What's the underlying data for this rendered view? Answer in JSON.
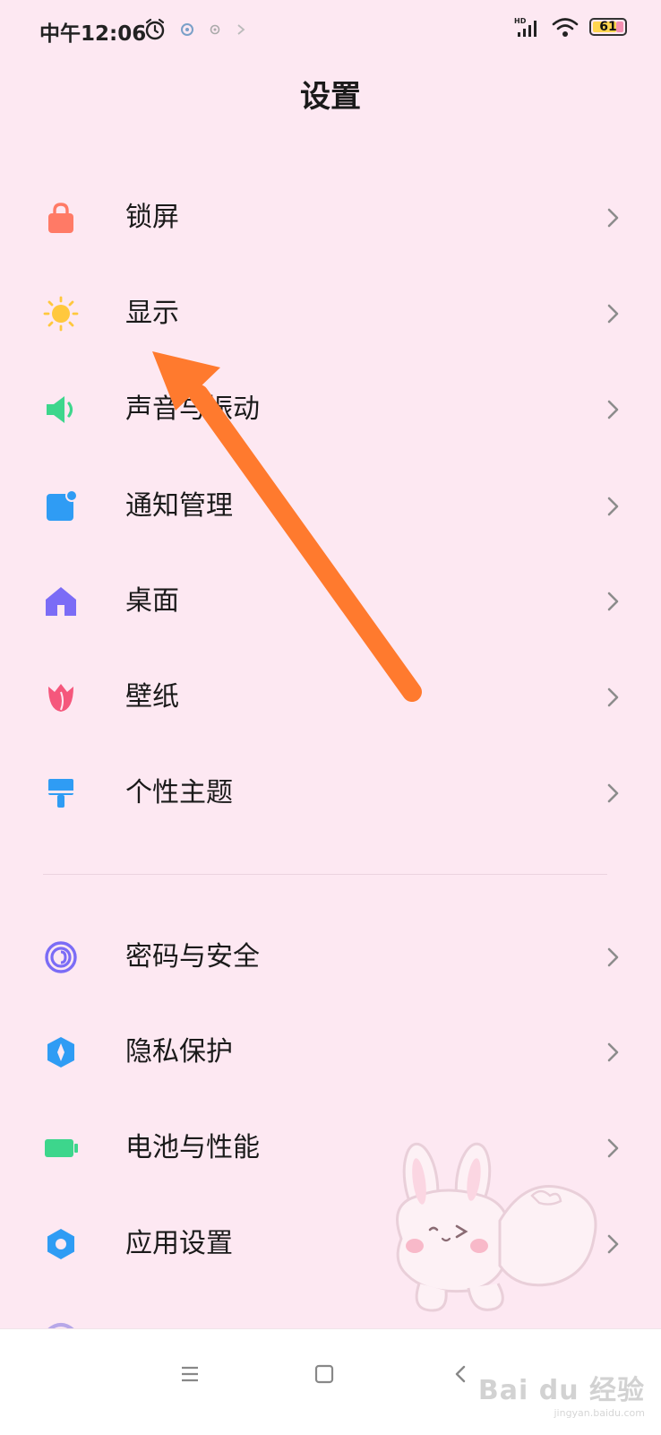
{
  "status_bar": {
    "time": "中午12:06",
    "battery_level": "61",
    "signal_label": "HD",
    "icons": [
      "alarm-icon",
      "app-notification-icon",
      "gear-notification-icon",
      "link-notification-icon",
      "hd-signal-icon",
      "wifi-icon",
      "battery-icon"
    ]
  },
  "page": {
    "title": "设置"
  },
  "settings": {
    "items": [
      {
        "label": "锁屏",
        "icon": "lock-icon",
        "color": "#ff7a66"
      },
      {
        "label": "显示",
        "icon": "sun-icon",
        "color": "#ffc83d"
      },
      {
        "label": "声音与振动",
        "icon": "speaker-icon",
        "color": "#3dd68c"
      },
      {
        "label": "通知管理",
        "icon": "notification-icon",
        "color": "#2f9cf4"
      },
      {
        "label": "桌面",
        "icon": "home-icon",
        "color": "#7b6cf6"
      },
      {
        "label": "壁纸",
        "icon": "tulip-icon",
        "color": "#f5577c"
      },
      {
        "label": "个性主题",
        "icon": "paintbrush-icon",
        "color": "#2f9cf4"
      },
      {
        "label": "密码与安全",
        "icon": "fingerprint-icon",
        "color": "#7b6cf6"
      },
      {
        "label": "隐私保护",
        "icon": "privacy-shield-icon",
        "color": "#2f9cf4"
      },
      {
        "label": "电池与性能",
        "icon": "battery-icon",
        "color": "#3dd68c"
      },
      {
        "label": "应用设置",
        "icon": "gear-icon",
        "color": "#2f9cf4"
      }
    ]
  },
  "annotation": {
    "arrow_color": "#ff7a2e"
  },
  "nav_bar": {
    "buttons": [
      "menu-icon",
      "home-square-icon",
      "back-icon"
    ]
  },
  "watermark": {
    "logo": "Bai du 经验",
    "sub": "jingyan.baidu.com"
  }
}
